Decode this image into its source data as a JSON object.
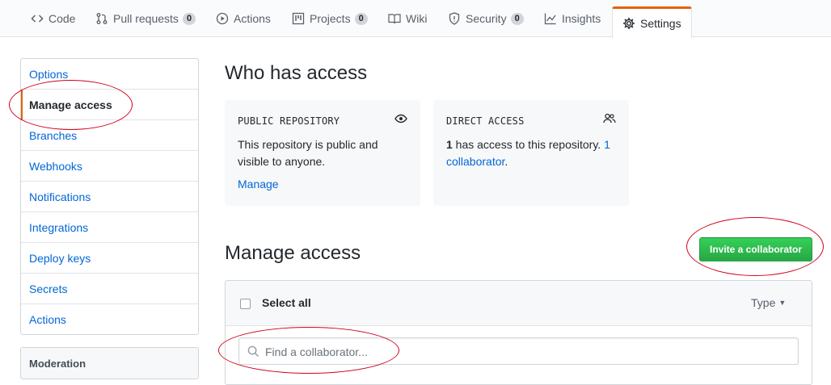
{
  "tabs": [
    {
      "label": "Code",
      "icon": "code-icon"
    },
    {
      "label": "Pull requests",
      "count": "0",
      "icon": "pull-request-icon"
    },
    {
      "label": "Actions",
      "icon": "play-icon"
    },
    {
      "label": "Projects",
      "count": "0",
      "icon": "project-icon"
    },
    {
      "label": "Wiki",
      "icon": "book-icon"
    },
    {
      "label": "Security",
      "count": "0",
      "icon": "shield-icon"
    },
    {
      "label": "Insights",
      "icon": "graph-icon"
    },
    {
      "label": "Settings",
      "icon": "gear-icon",
      "selected": true
    }
  ],
  "sidebar": {
    "items": [
      {
        "label": "Options"
      },
      {
        "label": "Manage access",
        "active": true
      },
      {
        "label": "Branches"
      },
      {
        "label": "Webhooks"
      },
      {
        "label": "Notifications"
      },
      {
        "label": "Integrations"
      },
      {
        "label": "Deploy keys"
      },
      {
        "label": "Secrets"
      },
      {
        "label": "Actions"
      }
    ],
    "moderation_title": "Moderation"
  },
  "access": {
    "title": "Who has access",
    "public_card": {
      "label": "PUBLIC REPOSITORY",
      "icon": "eye-icon",
      "text": "This repository is public and visible to anyone.",
      "link": "Manage"
    },
    "direct_card": {
      "label": "DIRECT ACCESS",
      "icon": "people-icon",
      "count": "1",
      "text_mid": " has access to this repository. ",
      "link": "1 collaborator",
      "tail": "."
    }
  },
  "manage": {
    "title": "Manage access",
    "invite_label": "Invite a collaborator",
    "select_all": "Select all",
    "type_label": "Type",
    "search_placeholder": "Find a collaborator..."
  },
  "colors": {
    "accent_orange": "#e36209",
    "link_blue": "#0366d6",
    "button_green": "#28a745",
    "annotation_red": "#d0021b"
  }
}
